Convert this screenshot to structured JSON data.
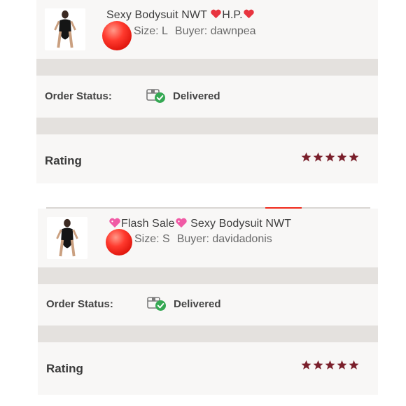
{
  "orders": [
    {
      "title_prefix": "",
      "title_main": "Sexy Bodysuit NWT ",
      "title_mid": "H.P.",
      "size_text": "Size: L",
      "buyer_text": "Buyer: dawnpea",
      "order_status_label": "Order Status:",
      "status_value": "Delivered",
      "rating_label": "Rating",
      "rating_stars": 5
    },
    {
      "title_prefix": "Flash Sale",
      "title_main": " Sexy Bodysuit NWT",
      "size_text": "Size: S",
      "buyer_text": "Buyer: davidadonis",
      "order_status_label": "Order Status:",
      "status_value": "Delivered",
      "rating_label": "Rating",
      "rating_stars": 5
    }
  ],
  "icons": {
    "heart": "red-heart-icon",
    "pink_heart": "sparkling-heart-icon",
    "status": "package-delivered-icon",
    "star": "star-icon"
  },
  "colors": {
    "star": "#7a1f2b",
    "heart_red": "#e8343f",
    "heart_pink": "#f05aa5",
    "check_green": "#35a853",
    "ball_red": "#f0291b",
    "panel_bg": "#f8f7f6",
    "divider_bg": "#e4e1de"
  }
}
